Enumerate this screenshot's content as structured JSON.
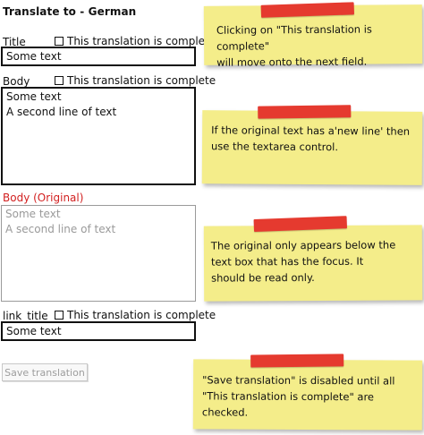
{
  "header": {
    "title": "Translate to - German"
  },
  "fields": {
    "title": {
      "label": "Title",
      "complete_label": "This translation is complete",
      "value": "Some text"
    },
    "body": {
      "label": "Body",
      "complete_label": "This translation is complete",
      "lines": [
        "Some text",
        "A second line of text"
      ]
    },
    "body_original": {
      "label": "Body (Original)",
      "lines": [
        "Some text",
        "A second line of text"
      ]
    },
    "link_title": {
      "label": "link_title",
      "complete_label": "This translation is complete",
      "value": "Some text"
    }
  },
  "actions": {
    "save_label": "Save translation"
  },
  "notes": {
    "note1": [
      "Clicking on \"This translation is complete\"",
      "will move onto the next field."
    ],
    "note2": [
      "If the original text has a'new line' then",
      "use the textarea control."
    ],
    "note3": [
      "The original only appears below the",
      "text box that has the focus. It",
      "should be read only."
    ],
    "note4": [
      "\"Save translation\" is disabled until all",
      "\"This translation is complete\" are",
      "checked."
    ]
  },
  "colors": {
    "note_yellow": "#f4ed8a",
    "tape_red": "#e53a2f",
    "original_label_red": "#d21f1f",
    "disabled_gray": "#9a9a9a"
  }
}
